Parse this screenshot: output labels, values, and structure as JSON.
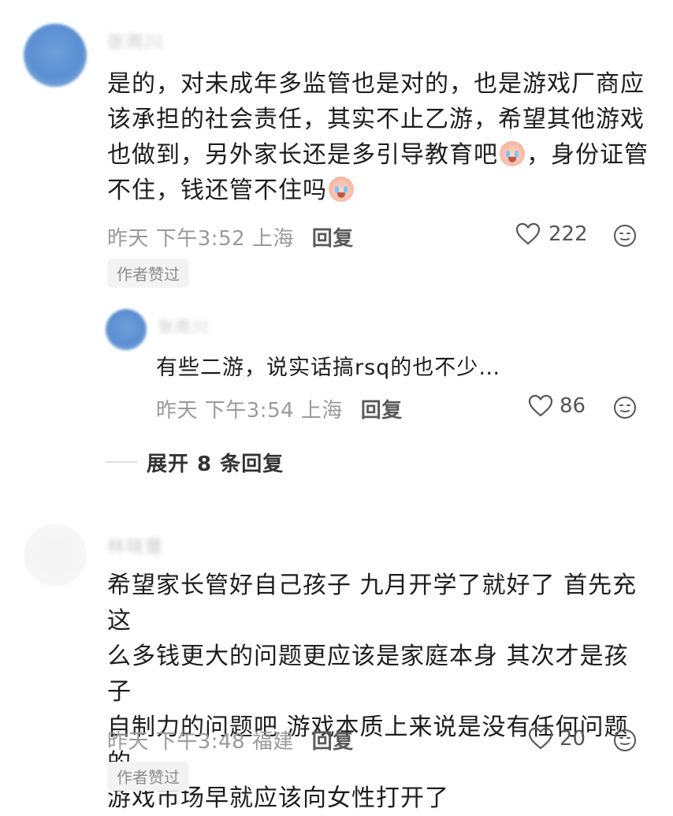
{
  "comments": [
    {
      "name": "张雨川",
      "text_lines": [
        "是的，对未成年多监管也是对的，也是游戏厂商应",
        "该承担的社会责任，其实不止乙游，希望其他游戏",
        "也做到，另外家长还是多引导教育吧",
        "，身份证管",
        "不住，钱还管不住吗"
      ],
      "emoji_name": "crying-face-emoji",
      "time": "昨天 下午3:52 上海",
      "reply_label": "回复",
      "likes": "222",
      "badge": "作者赞过",
      "reply": {
        "name": "张雨川",
        "text": "有些二游，说实话搞rsq的也不少…",
        "time": "昨天 下午3:54 上海",
        "reply_label": "回复",
        "likes": "86"
      },
      "expand_label": "展开 8 条回复"
    },
    {
      "name": "林晓蕾",
      "text_lines": [
        "希望家长管好自己孩子 九月开学了就好了 首先充这",
        "么多钱更大的问题更应该是家庭本身 其次才是孩子",
        "自制力的问题吧 游戏本质上来说是没有任何问题的",
        "游戏市场早就应该向女性打开了"
      ],
      "time": "昨天 下午3:48 福建",
      "reply_label": "回复",
      "likes": "20",
      "badge": "作者赞过"
    }
  ],
  "colors": {
    "text": "#1d1d1d",
    "meta": "#9a9a9a",
    "badge_bg": "#f3f3f3",
    "avatar_blue": "#5b8fd2"
  },
  "icons": [
    "heart-outline-icon",
    "emoji-face-icon"
  ]
}
